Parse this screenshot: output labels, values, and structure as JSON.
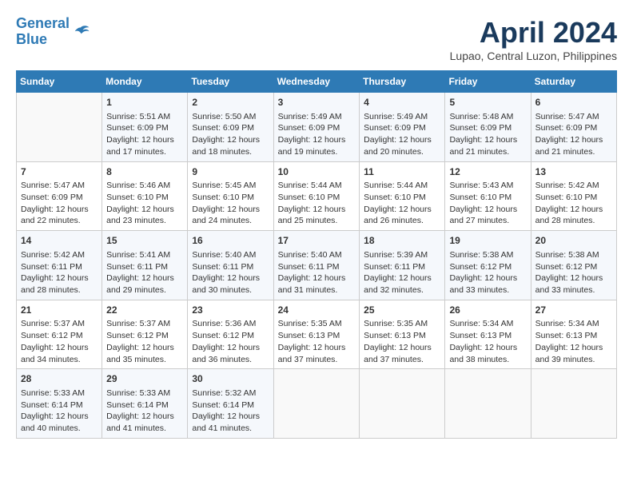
{
  "header": {
    "logo_line1": "General",
    "logo_line2": "Blue",
    "month_title": "April 2024",
    "location": "Lupao, Central Luzon, Philippines"
  },
  "days_of_week": [
    "Sunday",
    "Monday",
    "Tuesday",
    "Wednesday",
    "Thursday",
    "Friday",
    "Saturday"
  ],
  "weeks": [
    [
      {
        "day": "",
        "info": ""
      },
      {
        "day": "1",
        "info": "Sunrise: 5:51 AM\nSunset: 6:09 PM\nDaylight: 12 hours\nand 17 minutes."
      },
      {
        "day": "2",
        "info": "Sunrise: 5:50 AM\nSunset: 6:09 PM\nDaylight: 12 hours\nand 18 minutes."
      },
      {
        "day": "3",
        "info": "Sunrise: 5:49 AM\nSunset: 6:09 PM\nDaylight: 12 hours\nand 19 minutes."
      },
      {
        "day": "4",
        "info": "Sunrise: 5:49 AM\nSunset: 6:09 PM\nDaylight: 12 hours\nand 20 minutes."
      },
      {
        "day": "5",
        "info": "Sunrise: 5:48 AM\nSunset: 6:09 PM\nDaylight: 12 hours\nand 21 minutes."
      },
      {
        "day": "6",
        "info": "Sunrise: 5:47 AM\nSunset: 6:09 PM\nDaylight: 12 hours\nand 21 minutes."
      }
    ],
    [
      {
        "day": "7",
        "info": "Sunrise: 5:47 AM\nSunset: 6:09 PM\nDaylight: 12 hours\nand 22 minutes."
      },
      {
        "day": "8",
        "info": "Sunrise: 5:46 AM\nSunset: 6:10 PM\nDaylight: 12 hours\nand 23 minutes."
      },
      {
        "day": "9",
        "info": "Sunrise: 5:45 AM\nSunset: 6:10 PM\nDaylight: 12 hours\nand 24 minutes."
      },
      {
        "day": "10",
        "info": "Sunrise: 5:44 AM\nSunset: 6:10 PM\nDaylight: 12 hours\nand 25 minutes."
      },
      {
        "day": "11",
        "info": "Sunrise: 5:44 AM\nSunset: 6:10 PM\nDaylight: 12 hours\nand 26 minutes."
      },
      {
        "day": "12",
        "info": "Sunrise: 5:43 AM\nSunset: 6:10 PM\nDaylight: 12 hours\nand 27 minutes."
      },
      {
        "day": "13",
        "info": "Sunrise: 5:42 AM\nSunset: 6:10 PM\nDaylight: 12 hours\nand 28 minutes."
      }
    ],
    [
      {
        "day": "14",
        "info": "Sunrise: 5:42 AM\nSunset: 6:11 PM\nDaylight: 12 hours\nand 28 minutes."
      },
      {
        "day": "15",
        "info": "Sunrise: 5:41 AM\nSunset: 6:11 PM\nDaylight: 12 hours\nand 29 minutes."
      },
      {
        "day": "16",
        "info": "Sunrise: 5:40 AM\nSunset: 6:11 PM\nDaylight: 12 hours\nand 30 minutes."
      },
      {
        "day": "17",
        "info": "Sunrise: 5:40 AM\nSunset: 6:11 PM\nDaylight: 12 hours\nand 31 minutes."
      },
      {
        "day": "18",
        "info": "Sunrise: 5:39 AM\nSunset: 6:11 PM\nDaylight: 12 hours\nand 32 minutes."
      },
      {
        "day": "19",
        "info": "Sunrise: 5:38 AM\nSunset: 6:12 PM\nDaylight: 12 hours\nand 33 minutes."
      },
      {
        "day": "20",
        "info": "Sunrise: 5:38 AM\nSunset: 6:12 PM\nDaylight: 12 hours\nand 33 minutes."
      }
    ],
    [
      {
        "day": "21",
        "info": "Sunrise: 5:37 AM\nSunset: 6:12 PM\nDaylight: 12 hours\nand 34 minutes."
      },
      {
        "day": "22",
        "info": "Sunrise: 5:37 AM\nSunset: 6:12 PM\nDaylight: 12 hours\nand 35 minutes."
      },
      {
        "day": "23",
        "info": "Sunrise: 5:36 AM\nSunset: 6:12 PM\nDaylight: 12 hours\nand 36 minutes."
      },
      {
        "day": "24",
        "info": "Sunrise: 5:35 AM\nSunset: 6:13 PM\nDaylight: 12 hours\nand 37 minutes."
      },
      {
        "day": "25",
        "info": "Sunrise: 5:35 AM\nSunset: 6:13 PM\nDaylight: 12 hours\nand 37 minutes."
      },
      {
        "day": "26",
        "info": "Sunrise: 5:34 AM\nSunset: 6:13 PM\nDaylight: 12 hours\nand 38 minutes."
      },
      {
        "day": "27",
        "info": "Sunrise: 5:34 AM\nSunset: 6:13 PM\nDaylight: 12 hours\nand 39 minutes."
      }
    ],
    [
      {
        "day": "28",
        "info": "Sunrise: 5:33 AM\nSunset: 6:14 PM\nDaylight: 12 hours\nand 40 minutes."
      },
      {
        "day": "29",
        "info": "Sunrise: 5:33 AM\nSunset: 6:14 PM\nDaylight: 12 hours\nand 41 minutes."
      },
      {
        "day": "30",
        "info": "Sunrise: 5:32 AM\nSunset: 6:14 PM\nDaylight: 12 hours\nand 41 minutes."
      },
      {
        "day": "",
        "info": ""
      },
      {
        "day": "",
        "info": ""
      },
      {
        "day": "",
        "info": ""
      },
      {
        "day": "",
        "info": ""
      }
    ]
  ]
}
